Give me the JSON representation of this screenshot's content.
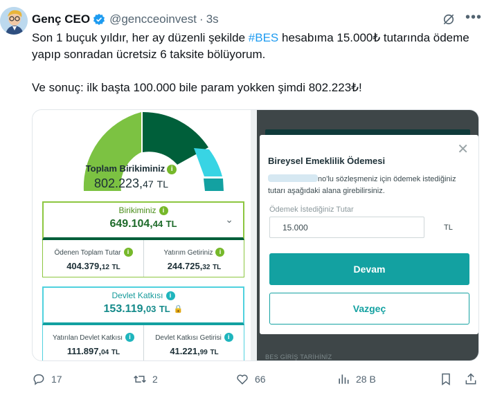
{
  "author": {
    "name": "Genç CEO",
    "handle": "@gencceoinvest",
    "separator": "·",
    "time": "3s"
  },
  "tweet": {
    "line1_pre": "Son 1 buçuk yıldır, her ay düzenli şekilde ",
    "hashtag": "#BES",
    "line1_post": " hesabıma 15.000₺ tutarında ödeme yapıp sonradan ücretsiz 6 taksite bölüyorum.",
    "paragraph2": "Ve sonuç: ilk başta 100.000 bile param yokken şimdi 802.223₺!"
  },
  "app": {
    "gauge": {
      "title": "Toplam Birikiminiz",
      "value_int": "802.223,",
      "value_dec": "47",
      "currency": "TL"
    },
    "savings": {
      "title": "Birikiminiz",
      "value_int": "649.104,",
      "value_dec": "44",
      "currency": "TL",
      "paid_label": "Ödenen Toplam Tutar",
      "paid_int": "404.379,",
      "paid_dec": "12",
      "return_label": "Yatırım Getiriniz",
      "return_int": "244.725,",
      "return_dec": "32",
      "currency_small": "TL"
    },
    "state": {
      "title": "Devlet Katkısı",
      "value_int": "153.119,",
      "value_dec": "03",
      "currency": "TL",
      "deposited_label": "Yatırılan Devlet Katkısı",
      "deposited_int": "111.897,",
      "deposited_dec": "04",
      "return_label": "Devlet Katkısı Getirisi",
      "return_int": "41.221,",
      "return_dec": "99",
      "currency_small": "TL"
    },
    "modal": {
      "title": "Bireysel Emeklilik Ödemesi",
      "desc_part1": "no'lu sözleşmeniz için ödemek istediğiniz",
      "desc_part2": "tutarı aşağıdaki alana girebilirsiniz.",
      "amount_label": "Ödemek İstediğiniz Tutar",
      "amount_value": "15.000",
      "amount_unit": "TL",
      "confirm_label": "Devam",
      "cancel_label": "Vazgeç",
      "close": "✕"
    },
    "background_label": "BES GİRİŞ TARİHİNİZ",
    "colors": {
      "light_green": "#8cc63f",
      "dark_green": "#005f3a",
      "cyan": "#4fd1de",
      "teal": "#13a1a1"
    }
  },
  "actions": {
    "replies": "17",
    "reposts": "2",
    "likes": "66",
    "views": "28 B"
  },
  "icons": {
    "verified": "verified-badge-icon",
    "grok": "grok-icon",
    "more": "more-icon",
    "reply": "reply-icon",
    "repost": "repost-icon",
    "like": "heart-icon",
    "views": "views-icon",
    "bookmark": "bookmark-icon",
    "share": "share-icon",
    "lock": "lock-icon",
    "info": "info-icon",
    "chevron": "chevron-down-icon"
  }
}
